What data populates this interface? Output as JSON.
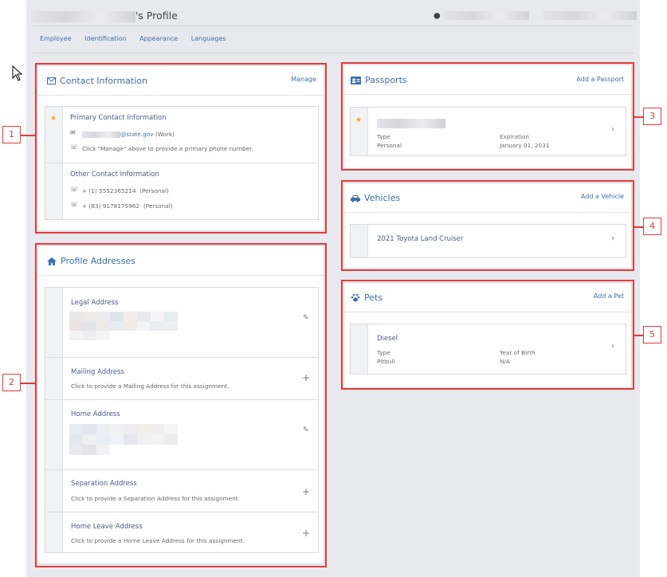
{
  "header": {
    "title_suffix": "'s Profile"
  },
  "tabs": [
    "Employee",
    "Identification",
    "Appearance",
    "Languages"
  ],
  "contact": {
    "title": "Contact Information",
    "action": "Manage",
    "primary_title": "Primary Contact Information",
    "email_suffix": "@state.gov",
    "email_type": "(Work)",
    "phone_hint": "Click \"Manage\" above to provide a primary phone number.",
    "other_title": "Other Contact Information",
    "phone1": "+ (1) 5552365214",
    "phone1_type": "(Personal)",
    "phone2": "+ (83) 9178175962",
    "phone2_type": "(Personal)"
  },
  "addresses": {
    "title": "Profile Addresses",
    "items": [
      {
        "label": "Legal Address",
        "hint": ""
      },
      {
        "label": "Mailing Address",
        "hint": "Click to provide a Mailing Address for this assignment."
      },
      {
        "label": "Home Address",
        "hint": ""
      },
      {
        "label": "Separation Address",
        "hint": "Click to provide a Separation Address for this assignment."
      },
      {
        "label": "Home Leave Address",
        "hint": "Click to provide a Home Leave Address for this assignment."
      }
    ]
  },
  "passports": {
    "title": "Passports",
    "action": "Add a Passport",
    "type_label": "Type",
    "type_value": "Personal",
    "exp_label": "Expiration",
    "exp_value": "January 01, 2031"
  },
  "vehicles": {
    "title": "Vehicles",
    "action": "Add a Vehicle",
    "item": "2021 Toyota Land Cruiser"
  },
  "pets": {
    "title": "Pets",
    "action": "Add a Pet",
    "name": "Diesel",
    "type_label": "Type",
    "type_value": "Pitbull",
    "yob_label": "Year of Birth",
    "yob_value": "N/A"
  },
  "callouts": [
    "1",
    "2",
    "3",
    "4",
    "5"
  ],
  "colors": {
    "accent": "#3a6fb0",
    "highlight": "#e23b3b",
    "star": "#f0b400"
  }
}
